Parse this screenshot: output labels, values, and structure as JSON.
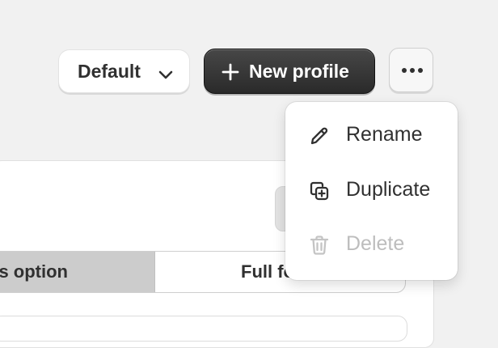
{
  "toolbar": {
    "profile_select_value": "Default",
    "new_profile_label": "New profile"
  },
  "menu": {
    "items": [
      {
        "label": "Rename",
        "icon": "pencil-icon",
        "disabled": false
      },
      {
        "label": "Duplicate",
        "icon": "duplicate-icon",
        "disabled": false
      },
      {
        "label": "Delete",
        "icon": "trash-icon",
        "disabled": true
      }
    ]
  },
  "card": {
    "segments": [
      "s option",
      "Full fo"
    ]
  },
  "colors": {
    "page_bg": "#f1f1f1",
    "primary_bg": "#303030",
    "disabled_text": "#bdbdbd",
    "selected_segment_bg": "#cccccc"
  }
}
